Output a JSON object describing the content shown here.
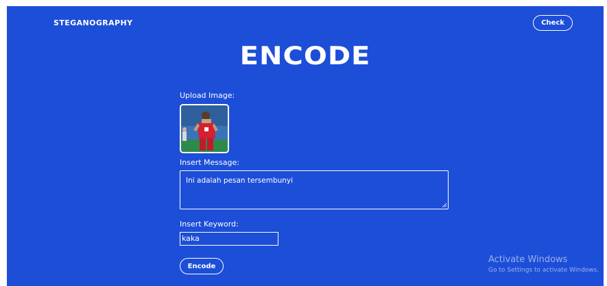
{
  "header": {
    "brand": "STEGANOGRAPHY",
    "check_label": "Check"
  },
  "main": {
    "title": "ENCODE",
    "upload_label": "Upload Image:",
    "message_label": "Insert Message:",
    "message_value": "Ini adalah pesan tersembunyi",
    "keyword_label": "Insert Keyword:",
    "keyword_value": "kaka",
    "encode_label": "Encode"
  },
  "watermark": {
    "title": "Activate Windows",
    "subtitle": "Go to Settings to activate Windows."
  },
  "colors": {
    "background": "#1d4ed8",
    "text": "#ffffff"
  },
  "icons": {
    "upload_preview": "uploaded-photo-thumbnail"
  }
}
